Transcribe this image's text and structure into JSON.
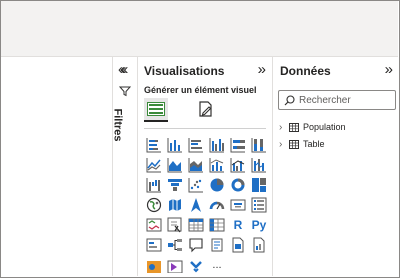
{
  "visualizations": {
    "title": "Visualisations",
    "build_visual_label": "Générer un élément visuel",
    "collapse_glyph": "«",
    "expand_glyph": "»"
  },
  "filters": {
    "label": "Filtres",
    "collapse_glyph": "«"
  },
  "data_pane": {
    "title": "Données",
    "expand_glyph": "»",
    "search_placeholder": "Rechercher",
    "tables": [
      {
        "name": "Population"
      },
      {
        "name": "Table"
      }
    ]
  },
  "visual_icons": [
    "stacked-bar-chart-icon",
    "stacked-column-chart-icon",
    "clustered-bar-chart-icon",
    "clustered-column-chart-icon",
    "100-stacked-bar-chart-icon",
    "100-stacked-column-chart-icon",
    "line-chart-icon",
    "area-chart-icon",
    "stacked-area-chart-icon",
    "line-stacked-column-chart-icon",
    "line-clustered-column-chart-icon",
    "ribbon-chart-icon",
    "waterfall-chart-icon",
    "funnel-chart-icon",
    "scatter-chart-icon",
    "pie-chart-icon",
    "donut-chart-icon",
    "treemap-icon",
    "map-icon",
    "filled-map-icon",
    "azure-map-icon",
    "gauge-icon",
    "card-icon",
    "multi-row-card-icon",
    "kpi-icon",
    "slicer-icon",
    "table-icon",
    "matrix-icon",
    "r-script-visual-icon",
    "python-visual-icon",
    "key-influencers-icon",
    "decomposition-tree-icon",
    "qa-icon",
    "narrative-icon",
    "paginated-report-icon",
    "report-page-icon",
    "arcgis-map-icon",
    "power-apps-icon",
    "power-automate-icon",
    "more-visuals-icon"
  ],
  "r_visual_text": "R",
  "python_visual_text": "Py",
  "more_text": "...",
  "colors": {
    "accent_blue": "#1f6fc5",
    "accent_green": "#3a8a3a",
    "accent_orange": "#e8962a"
  }
}
